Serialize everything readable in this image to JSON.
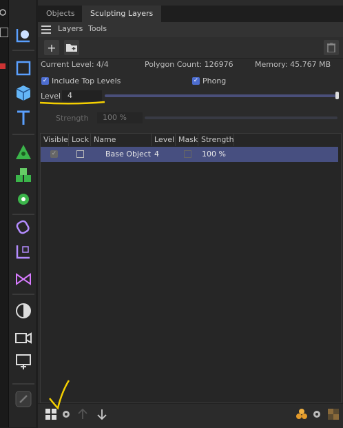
{
  "tabs": [
    "Objects",
    "Sculpting Layers"
  ],
  "menu": [
    "Layers",
    "Tools"
  ],
  "toolbar": {
    "add_layer": "+",
    "add_folder": "+"
  },
  "info": {
    "current_level": "Current Level: 4/4",
    "polygon_count": "Polygon Count: 126976",
    "memory": "Memory: 45.767 MB"
  },
  "options": {
    "include_top_levels": "Include Top Levels",
    "phong": "Phong",
    "level_label": "Level",
    "level_value": "4",
    "level_fraction": 1.0,
    "strength_label": "Strength",
    "strength_value": "100 %"
  },
  "table": {
    "headers": [
      "Visible",
      "Lock",
      "Name",
      "Level",
      "Mask",
      "Strength"
    ],
    "row": {
      "name": "Base Object",
      "level": "4",
      "strength": "100 %"
    }
  },
  "left_icons": [
    "null-icon",
    "cube-outline-icon",
    "cube-icon",
    "text-icon",
    "spline-icon",
    "mograph-icon",
    "cloner-icon",
    "deformer-icon",
    "field-icon",
    "effector-icon",
    "environment-icon",
    "camera-icon",
    "render-icon",
    "tool-icon"
  ],
  "colors": {
    "accent": "#4d6dcf",
    "selected_row": "#474f80",
    "annotation": "#f5d000"
  }
}
